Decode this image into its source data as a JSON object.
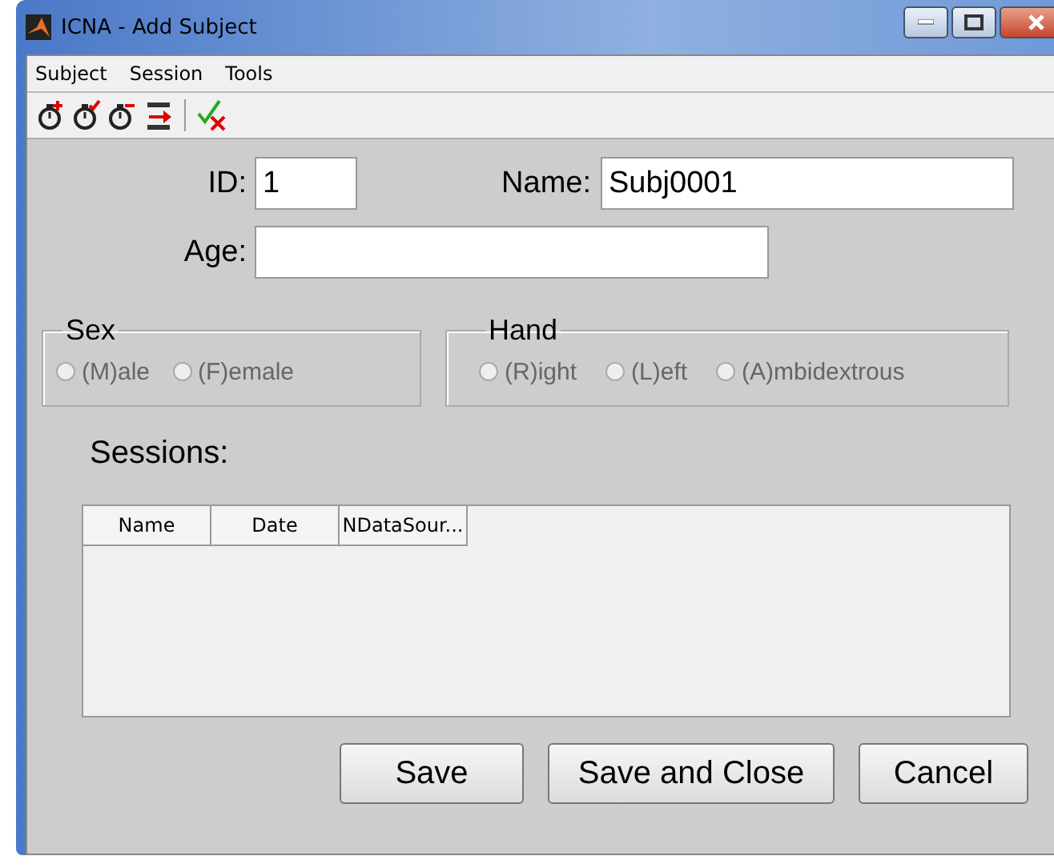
{
  "window": {
    "title": "ICNA - Add Subject"
  },
  "menu": [
    "Subject",
    "Session",
    "Tools"
  ],
  "toolbar": [
    {
      "kind": "add"
    },
    {
      "kind": "check"
    },
    {
      "kind": "remove"
    },
    {
      "kind": "import"
    },
    {
      "kind": "validate"
    }
  ],
  "fields": {
    "id": {
      "label": "ID:",
      "value": "1"
    },
    "name": {
      "label": "Name:",
      "value": "Subj0001"
    },
    "age": {
      "label": "Age:"
    }
  },
  "sex": {
    "title": "Sex",
    "options": [
      {
        "label": "(M)ale",
        "selected": false
      },
      {
        "label": "(F)emale",
        "selected": false
      }
    ]
  },
  "hand": {
    "title": "Hand",
    "options": [
      {
        "label": "(R)ight",
        "selected": false
      },
      {
        "label": "(L)eft",
        "selected": false
      },
      {
        "label": "(A)mbidextrous",
        "selected": false
      }
    ]
  },
  "sessions": {
    "label": "Sessions:",
    "columns": [
      "Name",
      "Date",
      "NDataSour..."
    ]
  },
  "buttons": [
    "Save",
    "Save and Close",
    "Cancel"
  ]
}
